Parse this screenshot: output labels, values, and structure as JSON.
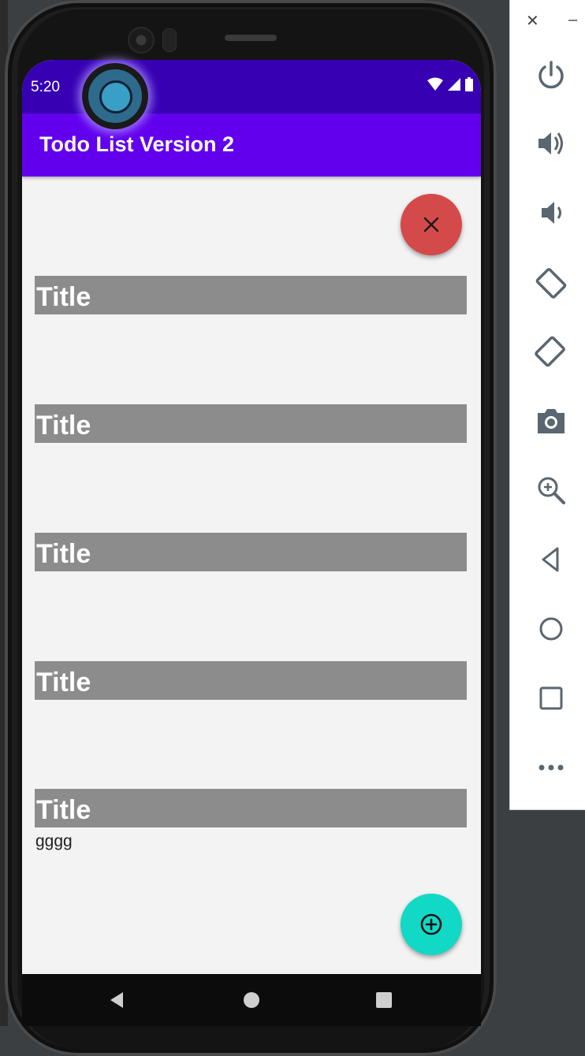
{
  "device": {
    "status_bar": {
      "time": "5:20"
    },
    "app_bar": {
      "title": "Todo List Version 2"
    }
  },
  "todos": [
    {
      "title": "Title",
      "description": ""
    },
    {
      "title": "Title",
      "description": ""
    },
    {
      "title": "Title",
      "description": ""
    },
    {
      "title": "Title",
      "description": ""
    },
    {
      "title": "Title",
      "description": "gggg"
    }
  ],
  "fabs": {
    "close": {
      "icon": "close-icon",
      "color": "#d44a4a"
    },
    "add": {
      "icon": "add-circle-icon",
      "color": "#12d8c6"
    }
  },
  "colors": {
    "status_bar": "#3700b3",
    "app_bar": "#6200ee",
    "title_bg": "#8c8c8c"
  },
  "emulator_toolbar": {
    "buttons": [
      "power-icon",
      "volume-up-icon",
      "volume-down-icon",
      "rotate-left-icon",
      "rotate-right-icon",
      "camera-icon",
      "zoom-icon",
      "back-icon",
      "home-icon",
      "overview-icon",
      "more-icon"
    ]
  }
}
